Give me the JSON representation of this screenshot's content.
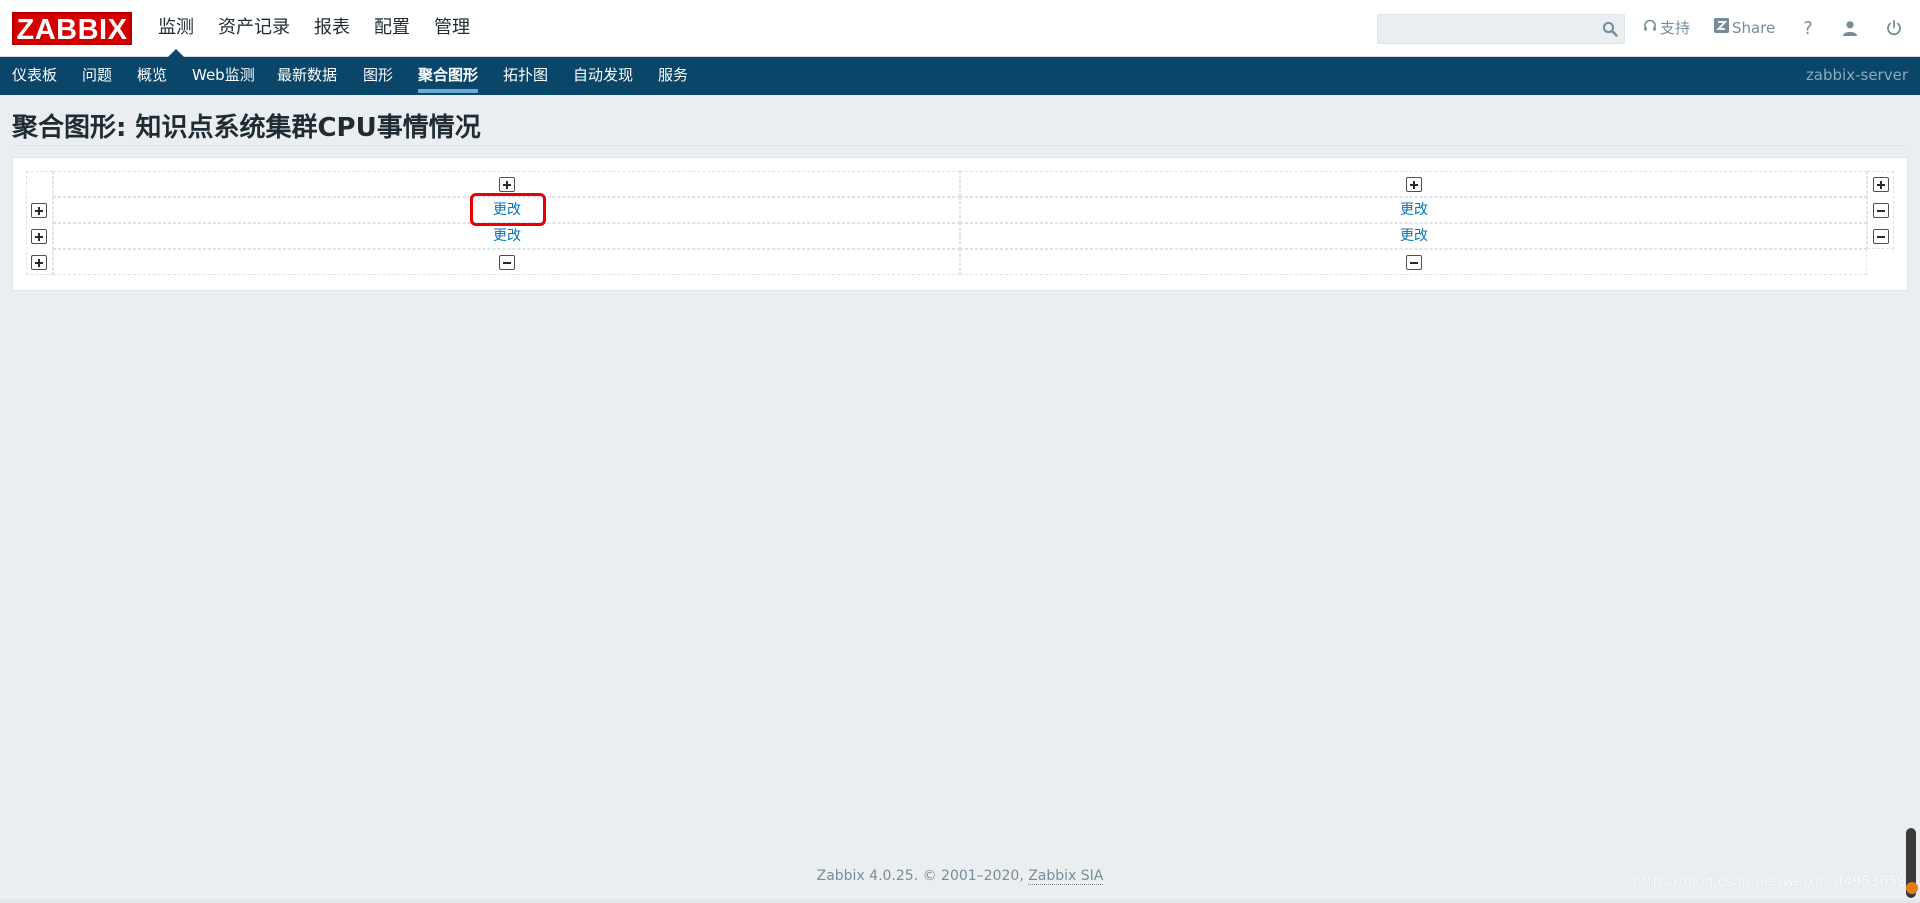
{
  "header": {
    "logo": "ZABBIX",
    "main_nav": [
      "监测",
      "资产记录",
      "报表",
      "配置",
      "管理"
    ],
    "main_nav_active": 0,
    "search": {
      "value": "",
      "placeholder": ""
    },
    "support_label": "支持",
    "share_label": "Share",
    "help_label": "?"
  },
  "subnav": {
    "items": [
      "仪表板",
      "问题",
      "概览",
      "Web监测",
      "最新数据",
      "图形",
      "聚合图形",
      "拓扑图",
      "自动发现",
      "服务"
    ],
    "active_index": 6,
    "server_name": "zabbix-server"
  },
  "page": {
    "title": "聚合图形: 知识点系统集群CPU事情情况"
  },
  "screen_editor": {
    "change_label": "更改",
    "rows": 2,
    "cols": 2,
    "highlighted_cell": "row 1, column 1"
  },
  "footer": {
    "text": "Zabbix 4.0.25. © 2001–2020,",
    "link": "Zabbix SIA"
  },
  "watermark": "https://blog.csdn.net/weixin_44953658",
  "colors": {
    "brand_red": "#d40000",
    "nav_dark": "#0a466a",
    "link_blue": "#0275b8",
    "highlight_red": "#e60000"
  }
}
